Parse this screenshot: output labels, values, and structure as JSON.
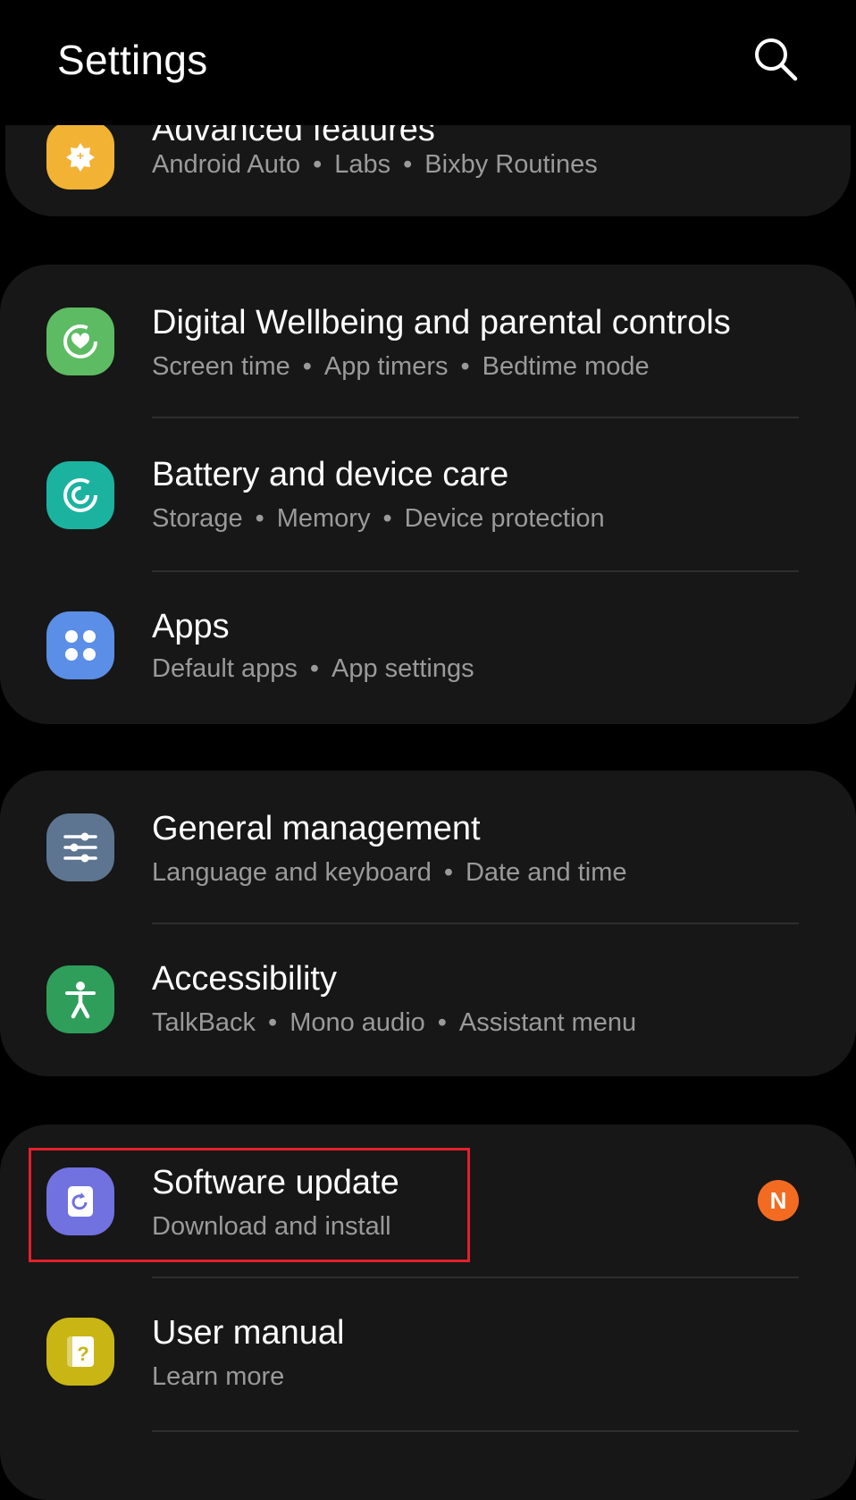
{
  "header": {
    "title": "Settings",
    "search_icon": "search-icon"
  },
  "advanced": {
    "title": "Advanced features",
    "sub": [
      "Android Auto",
      "Labs",
      "Bixby Routines"
    ],
    "icon_color": "#f2b233"
  },
  "group1": [
    {
      "title": "Digital Wellbeing and parental controls",
      "sub": [
        "Screen time",
        "App timers",
        "Bedtime mode"
      ],
      "icon_color": "#5dbb63"
    },
    {
      "title": "Battery and device care",
      "sub": [
        "Storage",
        "Memory",
        "Device protection"
      ],
      "icon_color": "#1bb3a0"
    },
    {
      "title": "Apps",
      "sub": [
        "Default apps",
        "App settings"
      ],
      "icon_color": "#5b8ee6"
    }
  ],
  "group2": [
    {
      "title": "General management",
      "sub": [
        "Language and keyboard",
        "Date and time"
      ],
      "icon_color": "#5d7590"
    },
    {
      "title": "Accessibility",
      "sub": [
        "TalkBack",
        "Mono audio",
        "Assistant menu"
      ],
      "icon_color": "#2f9e5b"
    }
  ],
  "group3": [
    {
      "title": "Software update",
      "sub": [
        "Download and install"
      ],
      "icon_color": "#7171e0",
      "badge": "N"
    },
    {
      "title": "User manual",
      "sub": [
        "Learn more"
      ],
      "icon_color": "#c9b614"
    }
  ],
  "colors": {
    "background": "#000000",
    "card": "#171717",
    "badge": "#f36b21",
    "highlight": "#e3202b"
  }
}
